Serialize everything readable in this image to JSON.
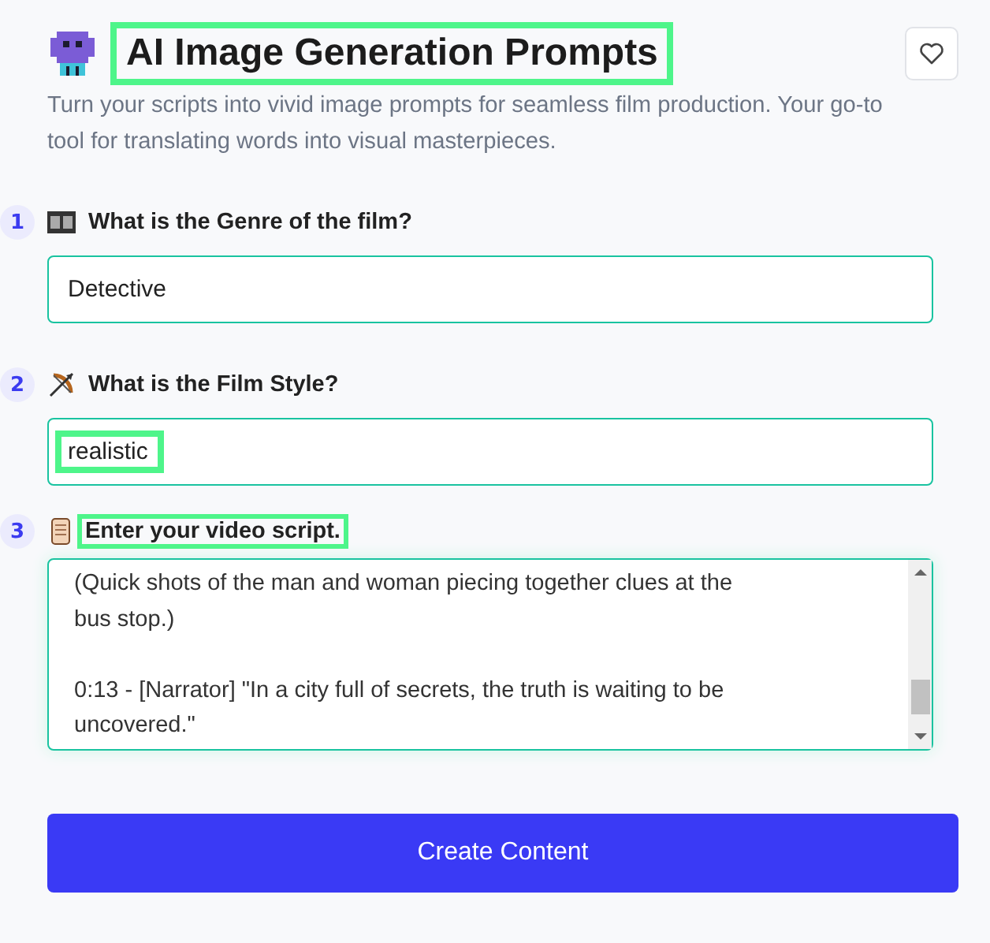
{
  "header": {
    "title": "AI Image Generation Prompts",
    "title_highlighted": true,
    "description": "Turn your scripts into vivid image prompts for seamless film production. Your go-to tool for translating words into visual masterpieces."
  },
  "fields": [
    {
      "number": "1",
      "kind": "input",
      "label": "What is the Genre of the film?",
      "label_highlighted": false,
      "value": "Detective",
      "value_highlighted": false
    },
    {
      "number": "2",
      "kind": "input",
      "label": "What is the Film Style?",
      "label_highlighted": false,
      "value": "realistic",
      "value_highlighted": true
    },
    {
      "number": "3",
      "kind": "textarea",
      "label": "Enter your video script.",
      "label_highlighted": true,
      "paragraphs": [
        [
          "(Quick shots of the man and woman piecing together clues at the",
          "bus stop.)"
        ],
        [
          "0:13 - [Narrator] \"In a city full of secrets, the truth is waiting to be",
          "uncovered.\""
        ]
      ]
    }
  ],
  "submit": {
    "label": "Create Content"
  }
}
